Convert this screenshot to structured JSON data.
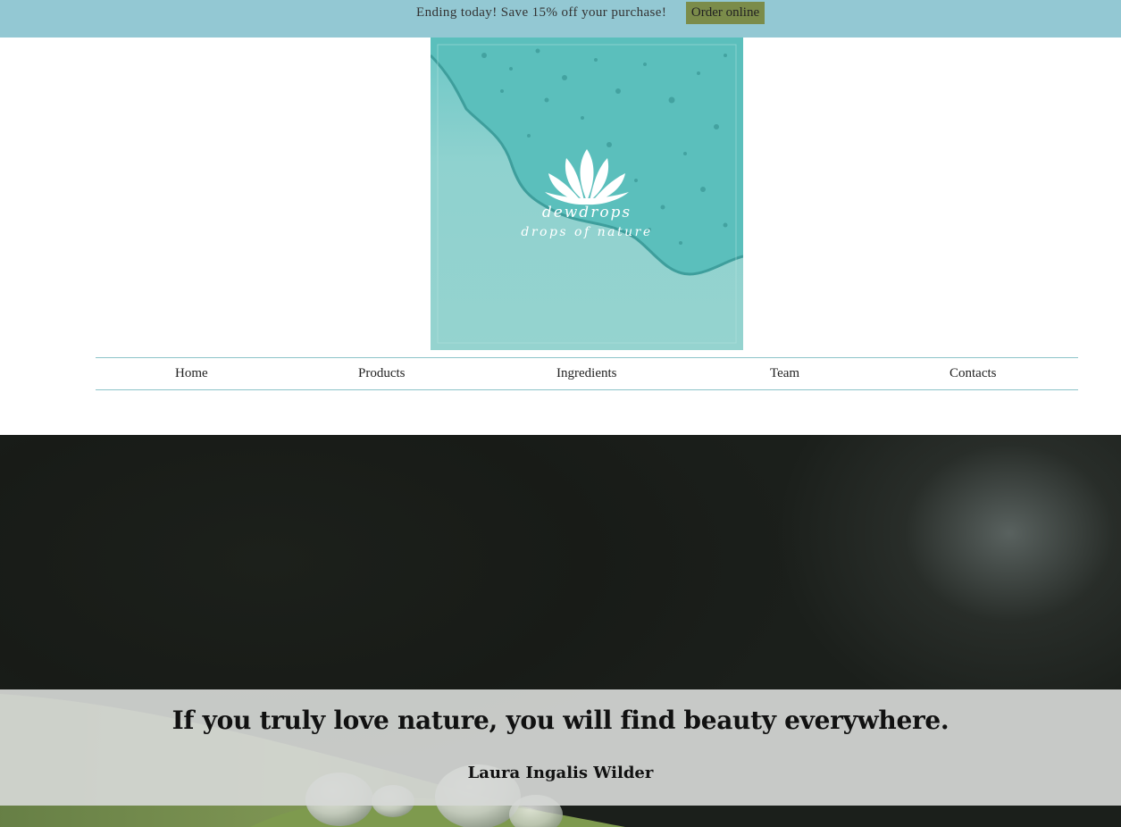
{
  "promo": {
    "text": "Ending today! Save 15% off your purchase!",
    "button_label": "Order online",
    "background": "#93c8d3",
    "button_color": "#7b8c4a"
  },
  "logo": {
    "brand": "dewdrops",
    "tagline": "drops of nature",
    "icon": "lotus-icon"
  },
  "nav": {
    "items": [
      {
        "label": "Home"
      },
      {
        "label": "Products"
      },
      {
        "label": "Ingredients"
      },
      {
        "label": "Team"
      },
      {
        "label": "Contacts"
      }
    ]
  },
  "hero": {
    "quote": "If you truly love nature, you will find beauty everywhere.",
    "author": "Laura Ingalis Wilder"
  }
}
